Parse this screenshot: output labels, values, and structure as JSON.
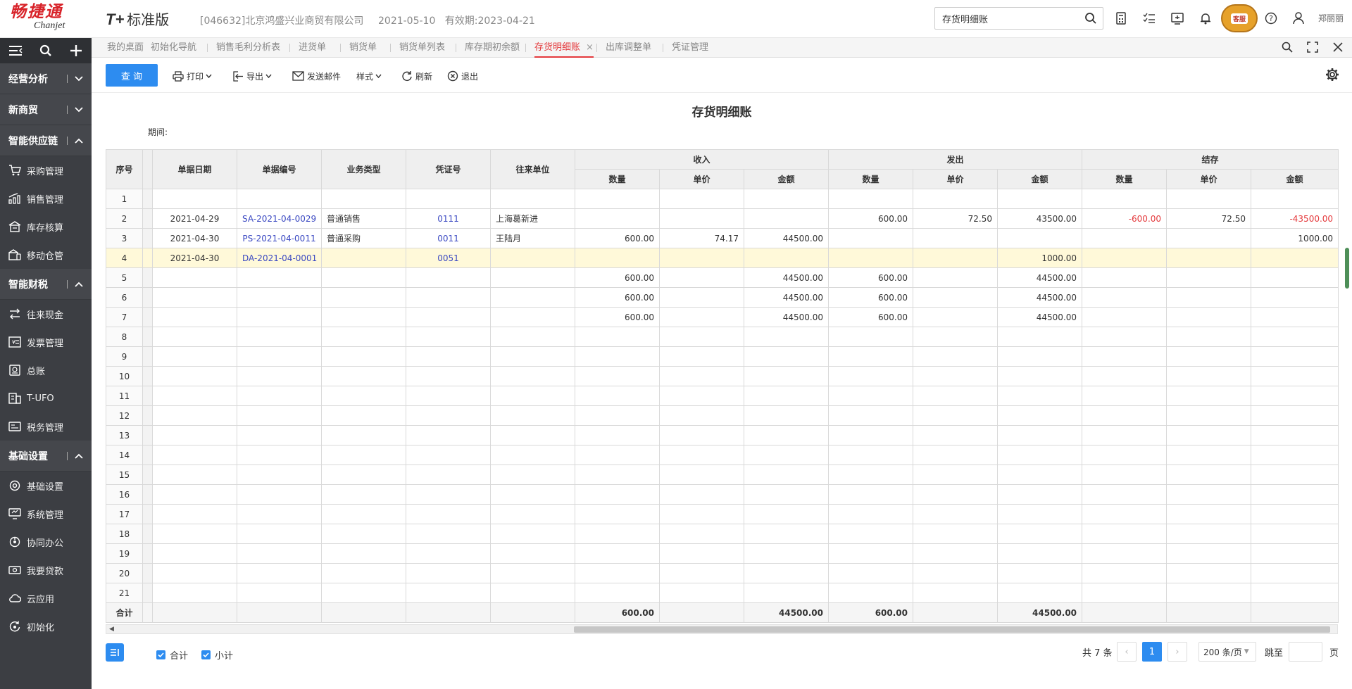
{
  "header": {
    "logo_cn": "畅捷通",
    "logo_en": "Chanjet",
    "product_mark": "T+",
    "edition": "标准版",
    "company": "[046632]北京鸿盛兴业商贸有限公司",
    "login_date": "2021-05-10",
    "expiry": "有效期:2023-04-21",
    "search_value": "存货明细账",
    "mascot_label": "客服",
    "user_name": "郑丽丽"
  },
  "sidebar": {
    "groups": [
      {
        "label": "经营分析",
        "items": []
      },
      {
        "label": "新商贸",
        "items": []
      },
      {
        "label": "智能供应链",
        "items": [
          {
            "label": "采购管理",
            "icon": "cart-icon"
          },
          {
            "label": "销售管理",
            "icon": "chart-icon"
          },
          {
            "label": "库存核算",
            "icon": "warehouse-icon"
          },
          {
            "label": "移动仓管",
            "icon": "mobile-store-icon"
          }
        ]
      },
      {
        "label": "智能财税",
        "items": [
          {
            "label": "往来现金",
            "icon": "exchange-icon"
          },
          {
            "label": "发票管理",
            "icon": "invoice-icon"
          },
          {
            "label": "总账",
            "icon": "ledger-icon"
          },
          {
            "label": "T-UFO",
            "icon": "report-icon"
          },
          {
            "label": "税务管理",
            "icon": "tax-icon"
          }
        ]
      },
      {
        "label": "基础设置",
        "items": [
          {
            "label": "基础设置",
            "icon": "settings-icon"
          },
          {
            "label": "系统管理",
            "icon": "monitor-icon"
          },
          {
            "label": "协同办公",
            "icon": "collab-icon"
          },
          {
            "label": "我要贷款",
            "icon": "loan-icon"
          },
          {
            "label": "云应用",
            "icon": "cloud-icon"
          },
          {
            "label": "初始化",
            "icon": "init-icon"
          }
        ]
      }
    ]
  },
  "tabs": [
    "我的桌面",
    "初始化导航",
    "销售毛利分析表",
    "进货单",
    "销货单",
    "销货单列表",
    "库存期初余额",
    "存货明细账",
    "出库调整单",
    "凭证管理"
  ],
  "active_tab": "存货明细账",
  "toolbar": {
    "query": "查 询",
    "print": "打印",
    "export": "导出",
    "email": "发送邮件",
    "style": "样式",
    "refresh": "刷新",
    "exit": "退出"
  },
  "report": {
    "title": "存货明细账",
    "period_label": "期间:"
  },
  "table": {
    "headers": {
      "seq": "序号",
      "date": "单据日期",
      "doc_no": "单据编号",
      "biz_type": "业务类型",
      "voucher": "凭证号",
      "partner": "往来单位",
      "in_group": "收入",
      "out_group": "发出",
      "bal_group": "结存",
      "qty": "数量",
      "price": "单价",
      "amount": "金额"
    },
    "rows": [
      {
        "seq": "1",
        "date": "",
        "doc_no": "",
        "biz_type": "",
        "voucher": "",
        "partner": "",
        "in_qty": "",
        "in_price": "",
        "in_amt": "",
        "out_qty": "",
        "out_price": "",
        "out_amt": "",
        "bal_qty": "",
        "bal_price": "",
        "bal_amt": ""
      },
      {
        "seq": "2",
        "date": "2021-04-29",
        "doc_no": "SA-2021-04-0029",
        "biz_type": "普通销售",
        "voucher": "0111",
        "partner": "上海葛新进",
        "in_qty": "",
        "in_price": "",
        "in_amt": "",
        "out_qty": "600.00",
        "out_price": "72.50",
        "out_amt": "43500.00",
        "bal_qty": "-600.00",
        "bal_price": "72.50",
        "bal_amt": "-43500.00"
      },
      {
        "seq": "3",
        "date": "2021-04-30",
        "doc_no": "PS-2021-04-0011",
        "biz_type": "普通采购",
        "voucher": "0011",
        "partner": "王陆月",
        "in_qty": "600.00",
        "in_price": "74.17",
        "in_amt": "44500.00",
        "out_qty": "",
        "out_price": "",
        "out_amt": "",
        "bal_qty": "",
        "bal_price": "",
        "bal_amt": "1000.00"
      },
      {
        "seq": "4",
        "date": "2021-04-30",
        "doc_no": "DA-2021-04-0001",
        "biz_type": "",
        "voucher": "0051",
        "partner": "",
        "in_qty": "",
        "in_price": "",
        "in_amt": "",
        "out_qty": "",
        "out_price": "",
        "out_amt": "1000.00",
        "bal_qty": "",
        "bal_price": "",
        "bal_amt": ""
      },
      {
        "seq": "5",
        "date": "",
        "doc_no": "",
        "biz_type": "",
        "voucher": "",
        "partner": "",
        "in_qty": "600.00",
        "in_price": "",
        "in_amt": "44500.00",
        "out_qty": "600.00",
        "out_price": "",
        "out_amt": "44500.00",
        "bal_qty": "",
        "bal_price": "",
        "bal_amt": ""
      },
      {
        "seq": "6",
        "date": "",
        "doc_no": "",
        "biz_type": "",
        "voucher": "",
        "partner": "",
        "in_qty": "600.00",
        "in_price": "",
        "in_amt": "44500.00",
        "out_qty": "600.00",
        "out_price": "",
        "out_amt": "44500.00",
        "bal_qty": "",
        "bal_price": "",
        "bal_amt": ""
      },
      {
        "seq": "7",
        "date": "",
        "doc_no": "",
        "biz_type": "",
        "voucher": "",
        "partner": "",
        "in_qty": "600.00",
        "in_price": "",
        "in_amt": "44500.00",
        "out_qty": "600.00",
        "out_price": "",
        "out_amt": "44500.00",
        "bal_qty": "",
        "bal_price": "",
        "bal_amt": ""
      },
      {
        "seq": "8"
      },
      {
        "seq": "9"
      },
      {
        "seq": "10"
      },
      {
        "seq": "11"
      },
      {
        "seq": "12"
      },
      {
        "seq": "13"
      },
      {
        "seq": "14"
      },
      {
        "seq": "15"
      },
      {
        "seq": "16"
      },
      {
        "seq": "17"
      },
      {
        "seq": "18"
      },
      {
        "seq": "19"
      },
      {
        "seq": "20"
      },
      {
        "seq": "21"
      }
    ],
    "highlighted_row": "4",
    "total": {
      "label": "合计",
      "in_qty": "600.00",
      "in_amt": "44500.00",
      "out_qty": "600.00",
      "out_amt": "44500.00"
    }
  },
  "footer": {
    "chk_total": "合计",
    "chk_subtotal": "小计",
    "total_count": "共 7 条",
    "current_page": "1",
    "page_size": "200 条/页",
    "jump_label": "跳至",
    "page_unit": "页"
  },
  "colors": {
    "accent": "#2d8cf0",
    "active_tab": "#e4393c",
    "sidebar": "#3c3e43",
    "highlight_row": "#fff9d9",
    "negative": "#e4393c",
    "link": "#3b49c2"
  }
}
